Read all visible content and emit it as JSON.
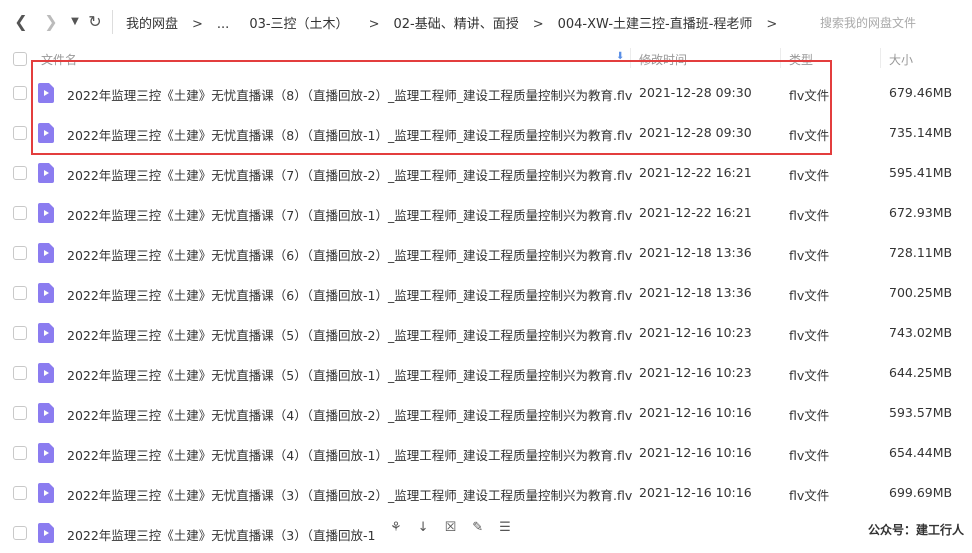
{
  "nav": {
    "breadcrumbs": [
      "我的网盘",
      "...",
      "03-三控（土木）",
      "02-基础、精讲、面授",
      "004-XW-土建三控-直播班-程老师"
    ],
    "search_placeholder": "搜索我的网盘文件"
  },
  "header": {
    "name": "文件名",
    "time": "修改时间",
    "type": "类型",
    "size": "大小"
  },
  "rows": [
    {
      "name": "2022年监理三控《土建》无忧直播课（8）（直播回放-2）_监理工程师_建设工程质量控制兴为教育.flv",
      "time": "2021-12-28 09:30",
      "type": "flv文件",
      "size": "679.46MB"
    },
    {
      "name": "2022年监理三控《土建》无忧直播课（8）（直播回放-1）_监理工程师_建设工程质量控制兴为教育.flv",
      "time": "2021-12-28 09:30",
      "type": "flv文件",
      "size": "735.14MB"
    },
    {
      "name": "2022年监理三控《土建》无忧直播课（7）（直播回放-2）_监理工程师_建设工程质量控制兴为教育.flv",
      "time": "2021-12-22 16:21",
      "type": "flv文件",
      "size": "595.41MB"
    },
    {
      "name": "2022年监理三控《土建》无忧直播课（7）（直播回放-1）_监理工程师_建设工程质量控制兴为教育.flv",
      "time": "2021-12-22 16:21",
      "type": "flv文件",
      "size": "672.93MB"
    },
    {
      "name": "2022年监理三控《土建》无忧直播课（6）（直播回放-2）_监理工程师_建设工程质量控制兴为教育.flv",
      "time": "2021-12-18 13:36",
      "type": "flv文件",
      "size": "728.11MB"
    },
    {
      "name": "2022年监理三控《土建》无忧直播课（6）（直播回放-1）_监理工程师_建设工程质量控制兴为教育.flv",
      "time": "2021-12-18 13:36",
      "type": "flv文件",
      "size": "700.25MB"
    },
    {
      "name": "2022年监理三控《土建》无忧直播课（5）（直播回放-2）_监理工程师_建设工程质量控制兴为教育.flv",
      "time": "2021-12-16 10:23",
      "type": "flv文件",
      "size": "743.02MB"
    },
    {
      "name": "2022年监理三控《土建》无忧直播课（5）（直播回放-1）_监理工程师_建设工程质量控制兴为教育.flv",
      "time": "2021-12-16 10:23",
      "type": "flv文件",
      "size": "644.25MB"
    },
    {
      "name": "2022年监理三控《土建》无忧直播课（4）（直播回放-2）_监理工程师_建设工程质量控制兴为教育.flv",
      "time": "2021-12-16 10:16",
      "type": "flv文件",
      "size": "593.57MB"
    },
    {
      "name": "2022年监理三控《土建》无忧直播课（4）（直播回放-1）_监理工程师_建设工程质量控制兴为教育.flv",
      "time": "2021-12-16 10:16",
      "type": "flv文件",
      "size": "654.44MB"
    },
    {
      "name": "2022年监理三控《土建》无忧直播课（3）（直播回放-2）_监理工程师_建设工程质量控制兴为教育.flv",
      "time": "2021-12-16 10:16",
      "type": "flv文件",
      "size": "699.69MB"
    },
    {
      "name": "2022年监理三控《土建》无忧直播课（3）（直播回放-1",
      "time": "",
      "type": "",
      "size": ""
    }
  ],
  "watermark": "公众号：建工行人",
  "icons": {
    "file": "video-file-icon",
    "accent": "#8b7cf0"
  }
}
